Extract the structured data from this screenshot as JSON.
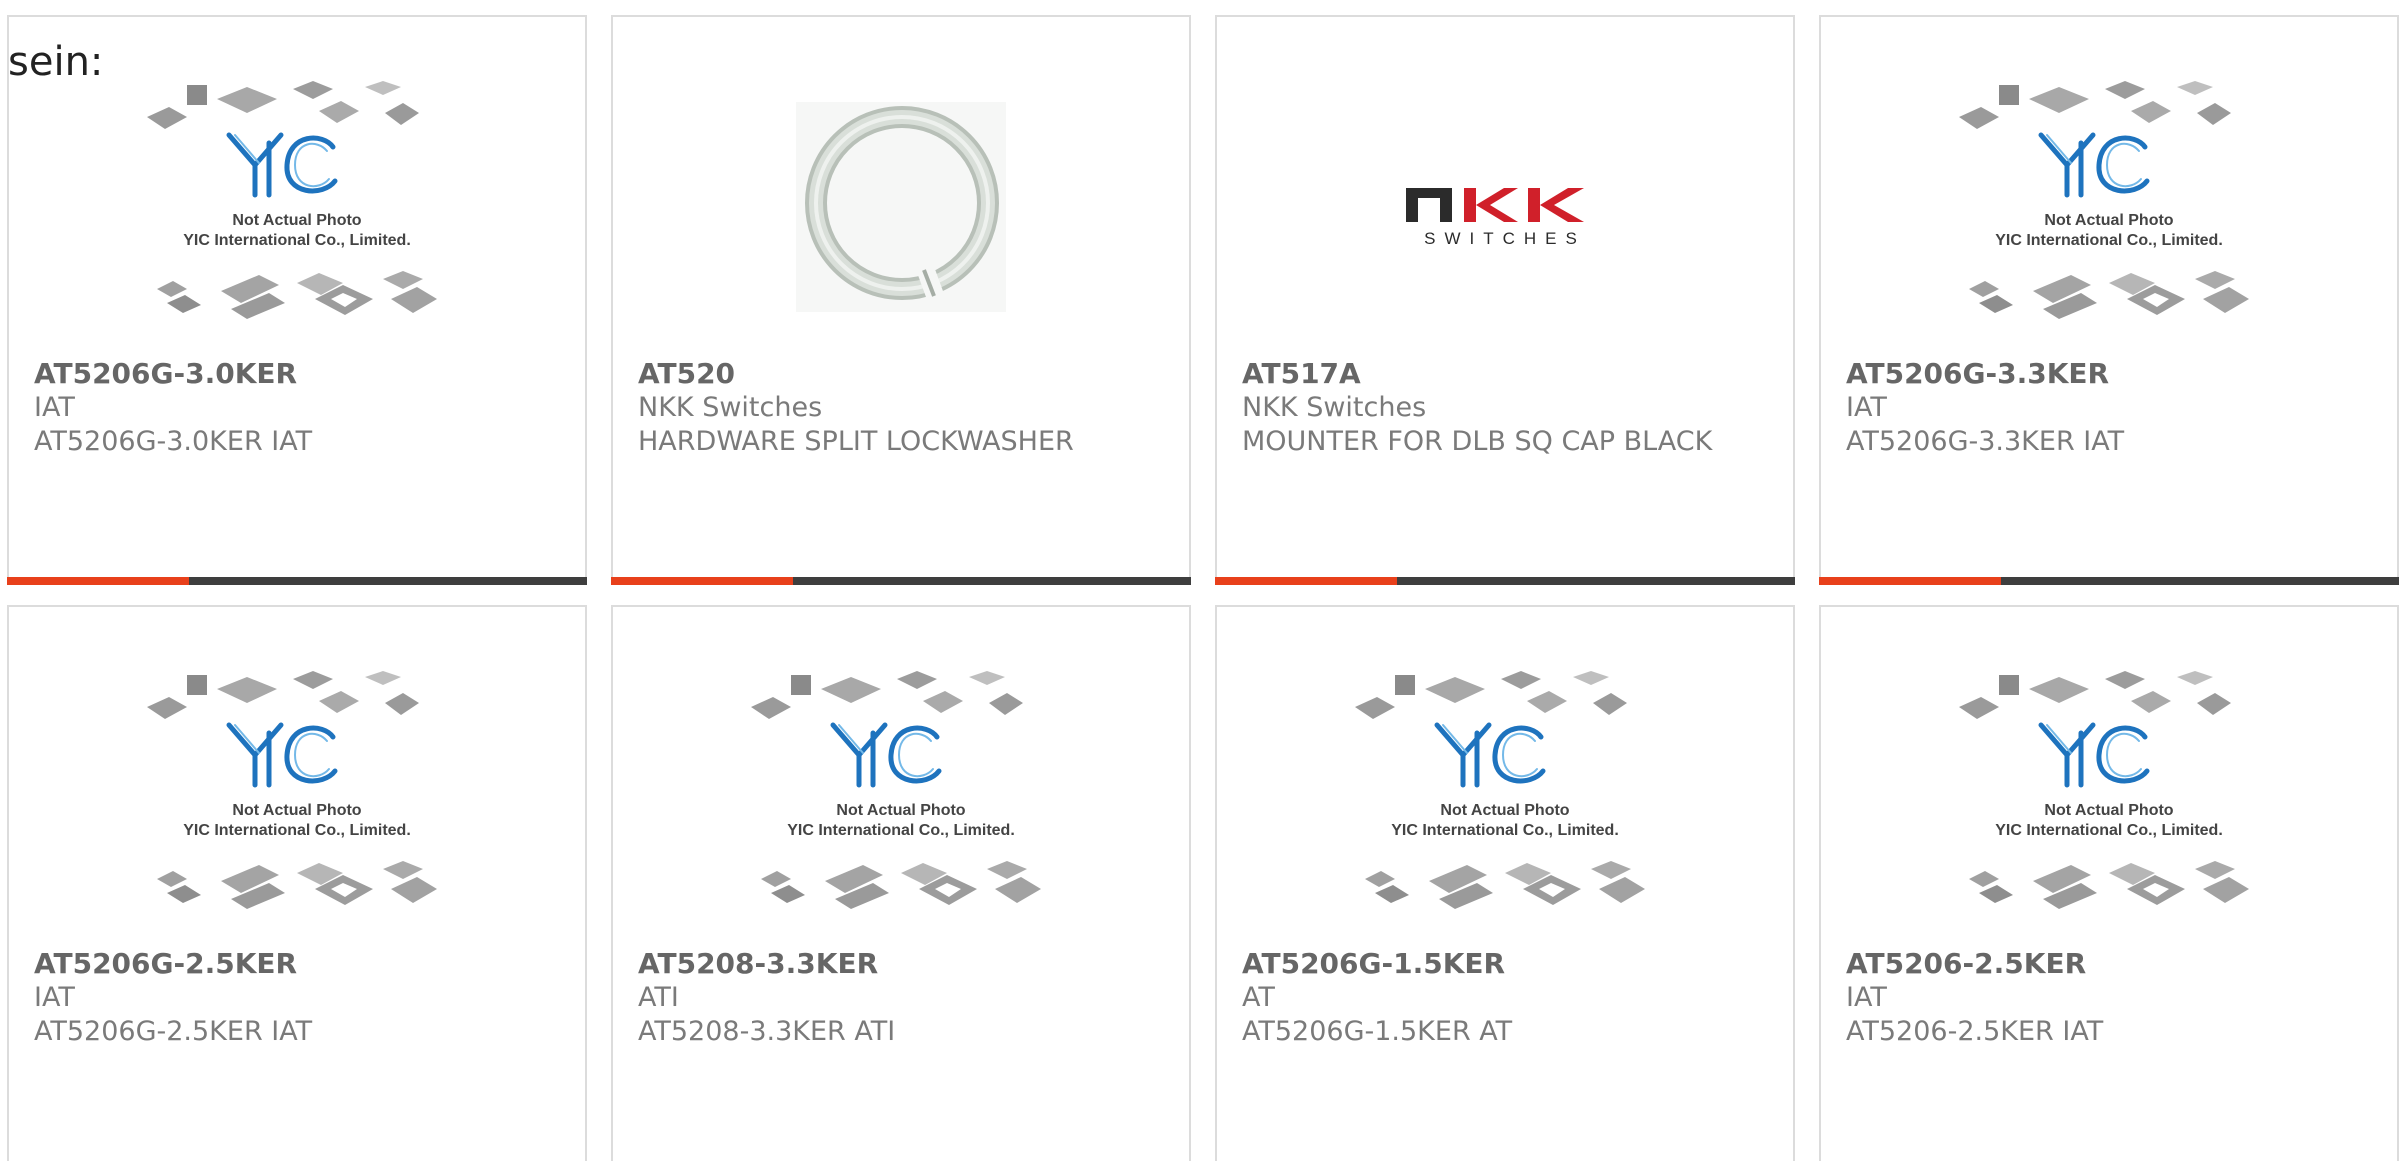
{
  "intro_text": "sein:",
  "placeholder_image": {
    "caption_line1": "Not Actual Photo",
    "caption_line2": "YIC International Co., Limited."
  },
  "nkk_logo": {
    "brand": "NKK",
    "subtitle": "SWITCHES"
  },
  "accent_color": "#e8401b",
  "bar_color": "#3e3e3e",
  "products": [
    {
      "part": "AT5206G-3.0KER",
      "maker": "IAT",
      "desc": "AT5206G-3.0KER IAT",
      "image": "yic-placeholder"
    },
    {
      "part": "AT520",
      "maker": "NKK Switches",
      "desc": "HARDWARE SPLIT LOCKWASHER",
      "image": "lockwasher-photo"
    },
    {
      "part": "AT517A",
      "maker": "NKK Switches",
      "desc": "MOUNTER FOR DLB SQ CAP BLACK",
      "image": "nkk-logo"
    },
    {
      "part": "AT5206G-3.3KER",
      "maker": "IAT",
      "desc": "AT5206G-3.3KER IAT",
      "image": "yic-placeholder"
    },
    {
      "part": "AT5206G-2.5KER",
      "maker": "IAT",
      "desc": "AT5206G-2.5KER IAT",
      "image": "yic-placeholder"
    },
    {
      "part": "AT5208-3.3KER",
      "maker": "ATI",
      "desc": "AT5208-3.3KER ATI",
      "image": "yic-placeholder"
    },
    {
      "part": "AT5206G-1.5KER",
      "maker": "AT",
      "desc": "AT5206G-1.5KER AT",
      "image": "yic-placeholder"
    },
    {
      "part": "AT5206-2.5KER",
      "maker": "IAT",
      "desc": "AT5206-2.5KER IAT",
      "image": "yic-placeholder"
    }
  ]
}
